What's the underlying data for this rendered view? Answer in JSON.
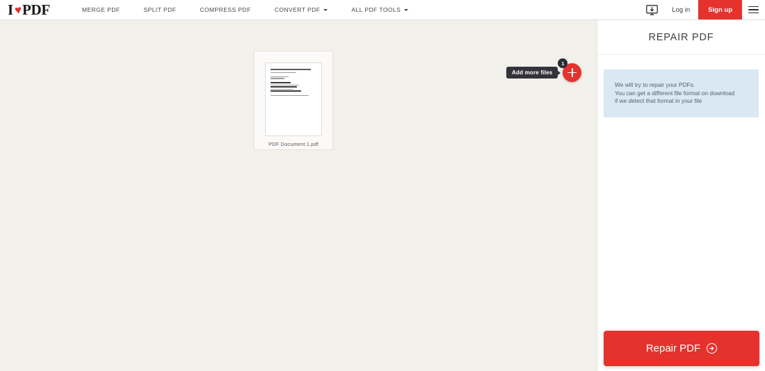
{
  "header": {
    "logo": {
      "part1": "I",
      "heart": "♥",
      "part2": "PDF",
      "heart_color": "#e5322d"
    },
    "nav": [
      {
        "label": "MERGE PDF",
        "has_caret": false
      },
      {
        "label": "SPLIT PDF",
        "has_caret": false
      },
      {
        "label": "COMPRESS PDF",
        "has_caret": false
      },
      {
        "label": "CONVERT PDF",
        "has_caret": true
      },
      {
        "label": "ALL PDF TOOLS",
        "has_caret": true
      }
    ],
    "desktop_icon": "desktop-download-icon",
    "login_label": "Log in",
    "signup_label": "Sign up",
    "signup_color": "#e5322d",
    "menu_icon": "hamburger-menu-icon"
  },
  "workspace": {
    "file": {
      "name": "PDF Document 1.pdf",
      "thumbnail_alt": "pdf-page-preview"
    },
    "add_more": {
      "tooltip": "Add more files",
      "badge_count": "1",
      "icon": "plus-icon",
      "button_color": "#e5322d"
    },
    "background_color": "#f2f0ea"
  },
  "sidebar": {
    "title": "REPAIR PDF",
    "info": {
      "line1": "We will try to repair your PDFs.",
      "line2": "You can get a different file format on download",
      "line3": "if we detect that format in your file",
      "background_color": "#d9e8f2"
    },
    "action_button": {
      "label": "Repair PDF",
      "icon": "arrow-right-circle-icon",
      "color": "#e5322d"
    }
  }
}
